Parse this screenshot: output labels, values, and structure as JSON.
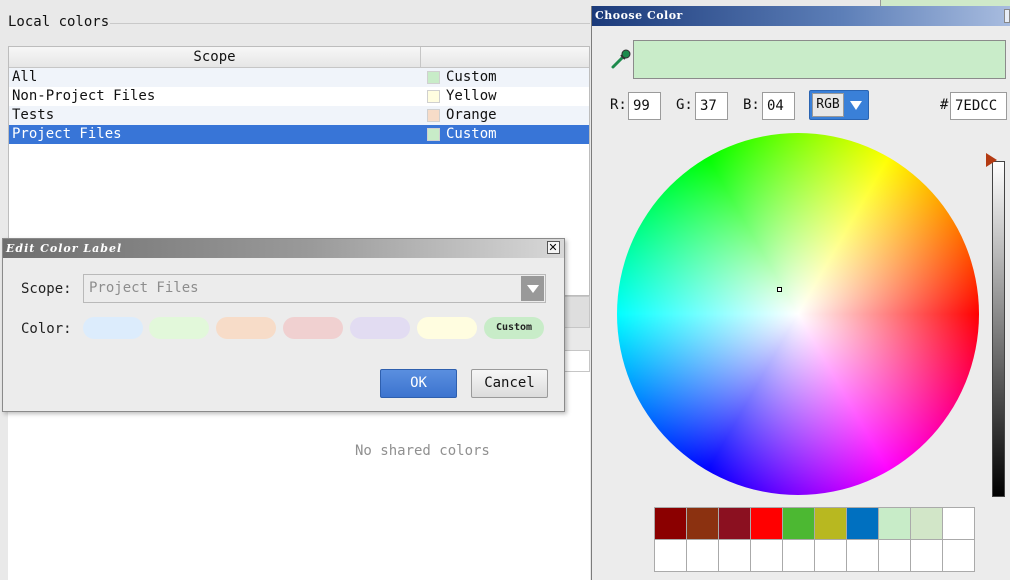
{
  "settings": {
    "section_title": "Local colors",
    "table": {
      "headers": [
        "Scope",
        ""
      ],
      "rows": [
        {
          "scope": "All",
          "color": "Custom",
          "swatch": "#c8ecc8"
        },
        {
          "scope": "Non-Project Files",
          "color": "Yellow",
          "swatch": "#fffde0"
        },
        {
          "scope": "Tests",
          "color": "Orange",
          "swatch": "#f7dcc8"
        },
        {
          "scope": "Project Files",
          "color": "Custom",
          "swatch": "#c8ecc8",
          "selected": true
        }
      ]
    },
    "shared_empty_text": "No shared colors"
  },
  "edit_dialog": {
    "title": "Edit Color Label",
    "close_glyph": "✕",
    "scope_label": "Scope:",
    "scope_value": "Project Files",
    "color_label": "Color:",
    "color_chips": [
      {
        "name": "blue",
        "color": "#dcecfc"
      },
      {
        "name": "green",
        "color": "#e2f8da"
      },
      {
        "name": "orange",
        "color": "#f7dcc8"
      },
      {
        "name": "rose",
        "color": "#f0d0d0"
      },
      {
        "name": "violet",
        "color": "#e2dcf2"
      },
      {
        "name": "yellow",
        "color": "#fffde0"
      },
      {
        "name": "custom",
        "color": "#c8ecc8",
        "label": "Custom"
      }
    ],
    "ok_label": "OK",
    "cancel_label": "Cancel"
  },
  "choose_dialog": {
    "title": "Choose Color",
    "preview_color": "#c9ecc9",
    "r_label": "R:",
    "r_value": "99",
    "g_label": "G:",
    "g_value": "37",
    "b_label": "B:",
    "b_value": "04",
    "mode_value": "RGB",
    "hex_label": "#",
    "hex_value": "7EDCC",
    "palette": [
      "#8b0000",
      "#8b3110",
      "#8b1020",
      "#ff0000",
      "#4cb832",
      "#b8b820",
      "#0070c0",
      "#c8ecc8",
      "#d2e6c8",
      "#ffffff",
      "#ffffff",
      "#ffffff",
      "#ffffff",
      "#ffffff",
      "#ffffff",
      "#ffffff",
      "#ffffff",
      "#ffffff",
      "#ffffff",
      "#ffffff"
    ]
  }
}
